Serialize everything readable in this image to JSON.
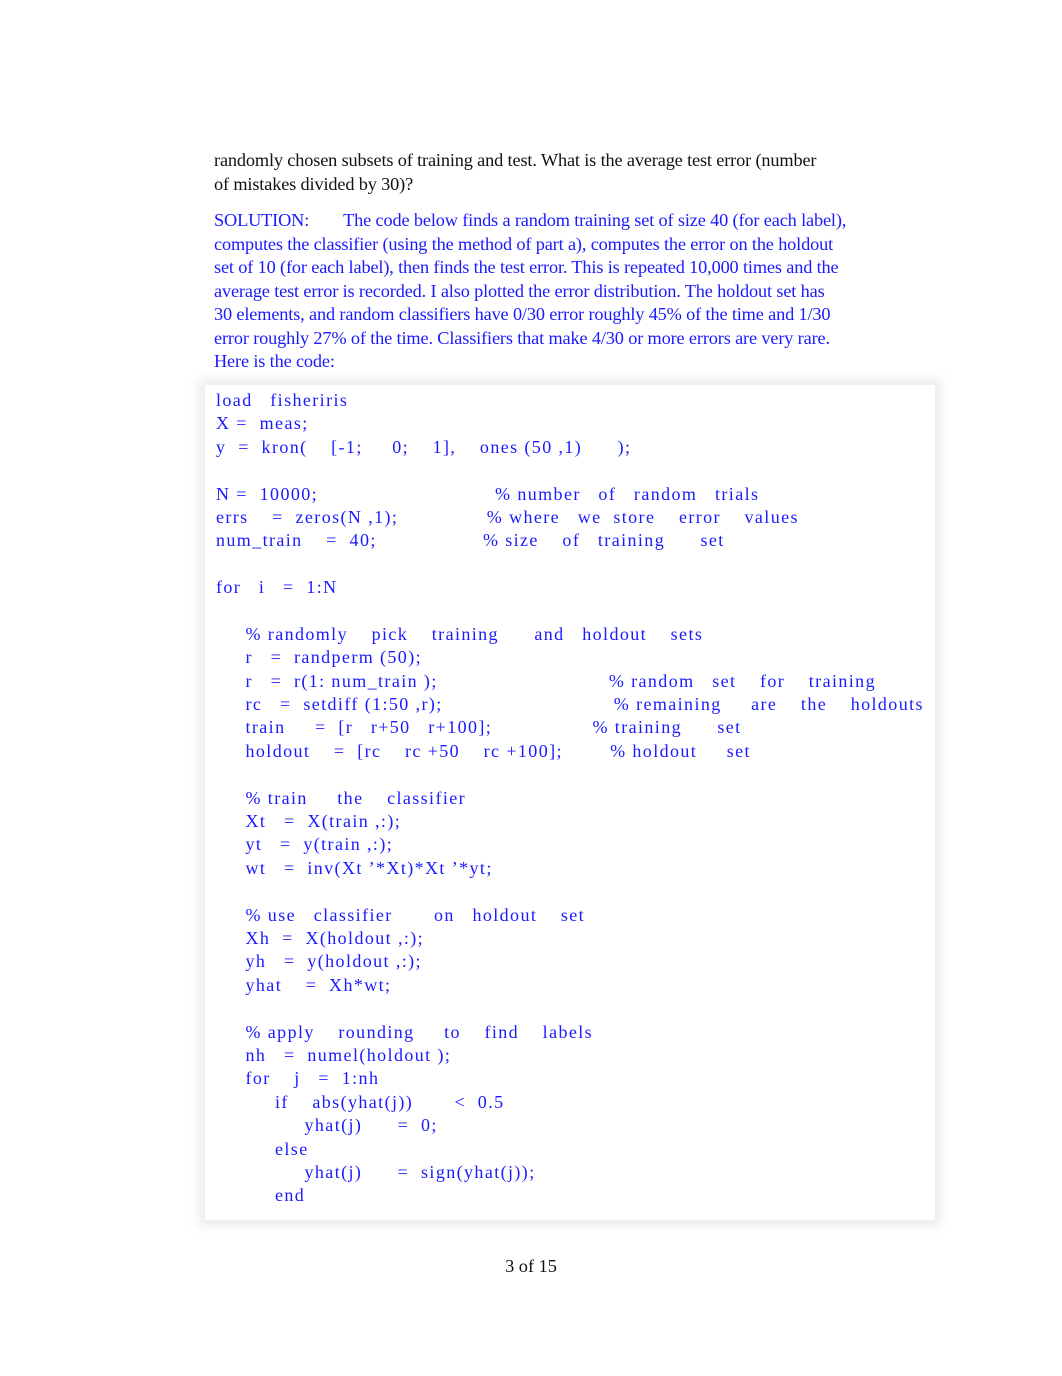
{
  "question": {
    "lines": [
      "randomly chosen subsets of training and test. What is the average test error (number",
      "of mistakes divided by 30)?"
    ]
  },
  "solution": {
    "label": "SOLUTION:",
    "lines": [
      "The code below finds a random training set of size 40 (for each label),",
      "computes the classifier (using the method of part a), computes the error on the holdout",
      "set of 10 (for each label), then finds the test error. This is repeated 10,000 times and the",
      "average test error is recorded. I also plotted the error distribution. The holdout set has",
      "30 elements, and random classifiers have 0/30 error roughly 45% of the time and 1/30",
      "error roughly 27% of the time. Classifiers that make 4/30 or more errors are very rare.",
      "Here is the code:"
    ]
  },
  "code": {
    "lines": [
      "load   fisheriris",
      "X =  meas;",
      "y  =  kron(    [-1;     0;    1],    ones (50 ,1)      );",
      "",
      "N =  10000;                              % number   of   random   trials",
      "errs    =  zeros(N ,1);               % where   we  store    error    values",
      "num_train    =  40;                  % size    of   training      set",
      "",
      "for   i   =  1:N",
      "",
      "     % randomly    pick    training      and   holdout    sets",
      "     r   =  randperm (50);",
      "     r   =  r(1: num_train );                             % random   set    for    training",
      "     rc   =  setdiff (1:50 ,r);                             % remaining     are    the    holdouts",
      "     train     =  [r   r+50   r+100];                 % training      set",
      "     holdout    =  [rc    rc +50    rc +100];        % holdout     set",
      "",
      "     % train     the    classifier",
      "     Xt   =  X(train ,:);",
      "     yt   =  y(train ,:);",
      "     wt   =  inv(Xt ’*Xt)*Xt ’*yt;",
      "",
      "     % use   classifier       on   holdout    set",
      "     Xh  =  X(holdout ,:);",
      "     yh   =  y(holdout ,:);",
      "     yhat    =  Xh*wt;",
      "",
      "     % apply    rounding     to    find    labels",
      "     nh   =  numel(holdout );",
      "     for    j   =  1:nh",
      "          if    abs(yhat(j))       <  0.5",
      "               yhat(j)      =  0;",
      "          else",
      "               yhat(j)      =  sign(yhat(j));",
      "          end"
    ]
  },
  "footer": {
    "page_indicator": "3 of 15"
  },
  "colors": {
    "solution_text": "#1a1aff",
    "body_text": "#111111"
  }
}
